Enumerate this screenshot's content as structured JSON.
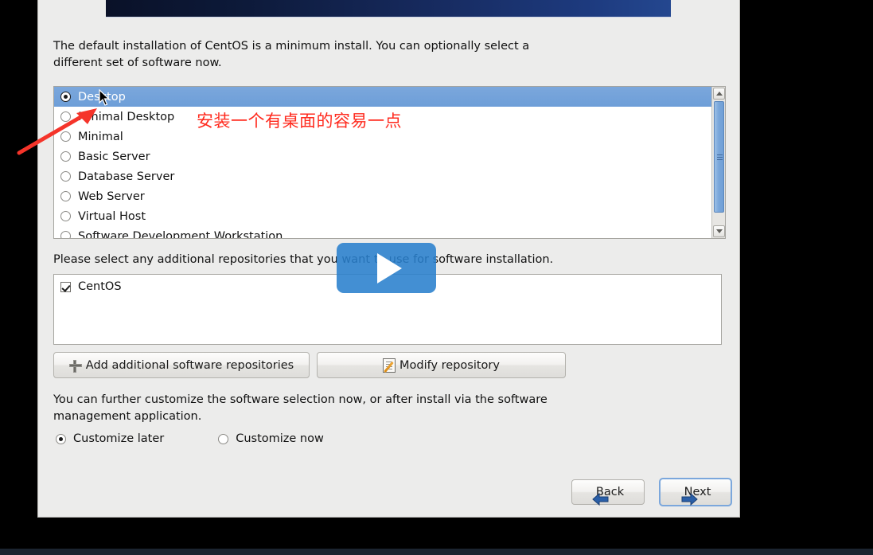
{
  "dialog": {
    "intro_text": "The default installation of CentOS is a minimum install. You can optionally select a different set of software now.",
    "repo_label": "Please select any additional repositories that you want to use for software installation.",
    "customize_text": "You can further customize the software selection now, or after install via the software management application."
  },
  "software_list": {
    "items": [
      {
        "label": "Desktop",
        "selected": true
      },
      {
        "label": "Minimal Desktop",
        "selected": false
      },
      {
        "label": "Minimal",
        "selected": false
      },
      {
        "label": "Basic Server",
        "selected": false
      },
      {
        "label": "Database Server",
        "selected": false
      },
      {
        "label": "Web Server",
        "selected": false
      },
      {
        "label": "Virtual Host",
        "selected": false
      },
      {
        "label": "Software Development Workstation",
        "selected": false
      }
    ]
  },
  "repositories": {
    "items": [
      {
        "label": "CentOS",
        "checked": true
      }
    ]
  },
  "buttons": {
    "add_repo": "Add additional software repositories",
    "modify_repo": "Modify repository",
    "back": "Back",
    "next": "Next"
  },
  "customize": {
    "later_label": "Customize later",
    "now_label": "Customize now",
    "selected": "later"
  },
  "annotation": {
    "note_text": "安装一个有桌面的容易一点",
    "note_color": "#ff2a1e"
  },
  "overlay": {
    "play_label": "play-button"
  },
  "colors": {
    "dialog_bg": "#ececeb",
    "selection_blue": "#6d9ed8",
    "banner_dark": "#0a1128",
    "banner_light": "#24478f",
    "annotation_red": "#ff2a1e",
    "play_blue": "#2980cd"
  }
}
